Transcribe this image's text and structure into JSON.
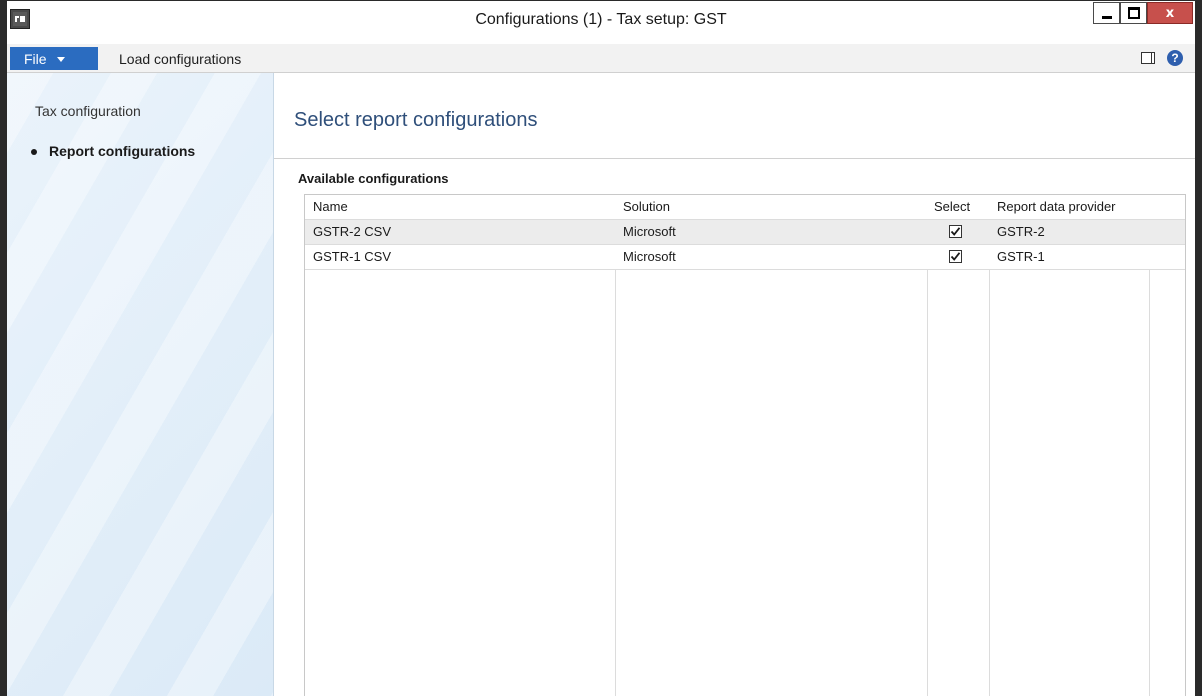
{
  "window": {
    "title": "Configurations (1) - Tax setup: GST",
    "close_glyph": "x"
  },
  "menubar": {
    "file_label": "File",
    "load_label": "Load configurations",
    "help_glyph": "?"
  },
  "nav": {
    "items": [
      {
        "label": "Tax configuration",
        "active": false
      },
      {
        "label": "Report configurations",
        "active": true
      }
    ]
  },
  "main": {
    "page_title": "Select report configurations",
    "section_label": "Available configurations"
  },
  "grid": {
    "columns": [
      "Name",
      "Solution",
      "Select",
      "Report data provider"
    ],
    "rows": [
      {
        "name": "GSTR-2 CSV",
        "solution": "Microsoft",
        "selected": true,
        "provider": "GSTR-2"
      },
      {
        "name": "GSTR-1 CSV",
        "solution": "Microsoft",
        "selected": true,
        "provider": "GSTR-1"
      }
    ]
  },
  "colors": {
    "accent": "#2b6cc0",
    "title_text": "#2f4f7a",
    "close_button": "#c7504c",
    "nav_bg": "#dbeaf7"
  },
  "icons": [
    "app-icon",
    "minimize-icon",
    "maximize-icon",
    "close-icon",
    "dropdown-caret-icon",
    "panel-icon",
    "help-icon",
    "checkbox-checked-icon"
  ]
}
